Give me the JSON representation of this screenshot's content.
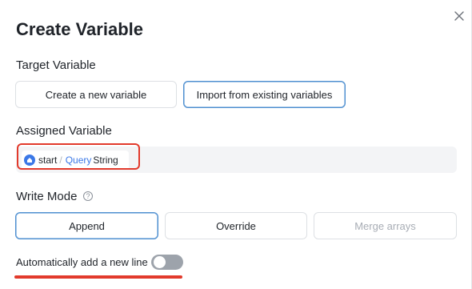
{
  "dialog": {
    "title": "Create Variable",
    "close_icon": "close-icon"
  },
  "target_variable": {
    "label": "Target Variable",
    "options": [
      {
        "label": "Create a new variable",
        "selected": false
      },
      {
        "label": "Import from existing variables",
        "selected": true
      }
    ]
  },
  "assigned_variable": {
    "label": "Assigned Variable",
    "chip": {
      "icon": "start-node-icon",
      "node": "start",
      "separator": "/",
      "query": "Query",
      "name": "String"
    }
  },
  "write_mode": {
    "label": "Write Mode",
    "help_icon": "help-icon",
    "help_glyph": "?",
    "options": [
      {
        "label": "Append",
        "selected": true,
        "disabled": false
      },
      {
        "label": "Override",
        "selected": false,
        "disabled": false
      },
      {
        "label": "Merge arrays",
        "selected": false,
        "disabled": true
      }
    ]
  },
  "auto_newline": {
    "label": "Automatically add a new line",
    "enabled": false
  },
  "colors": {
    "accent": "#4e8fd0",
    "highlight": "#e23a2c",
    "chip_blue": "#3b78e7"
  }
}
